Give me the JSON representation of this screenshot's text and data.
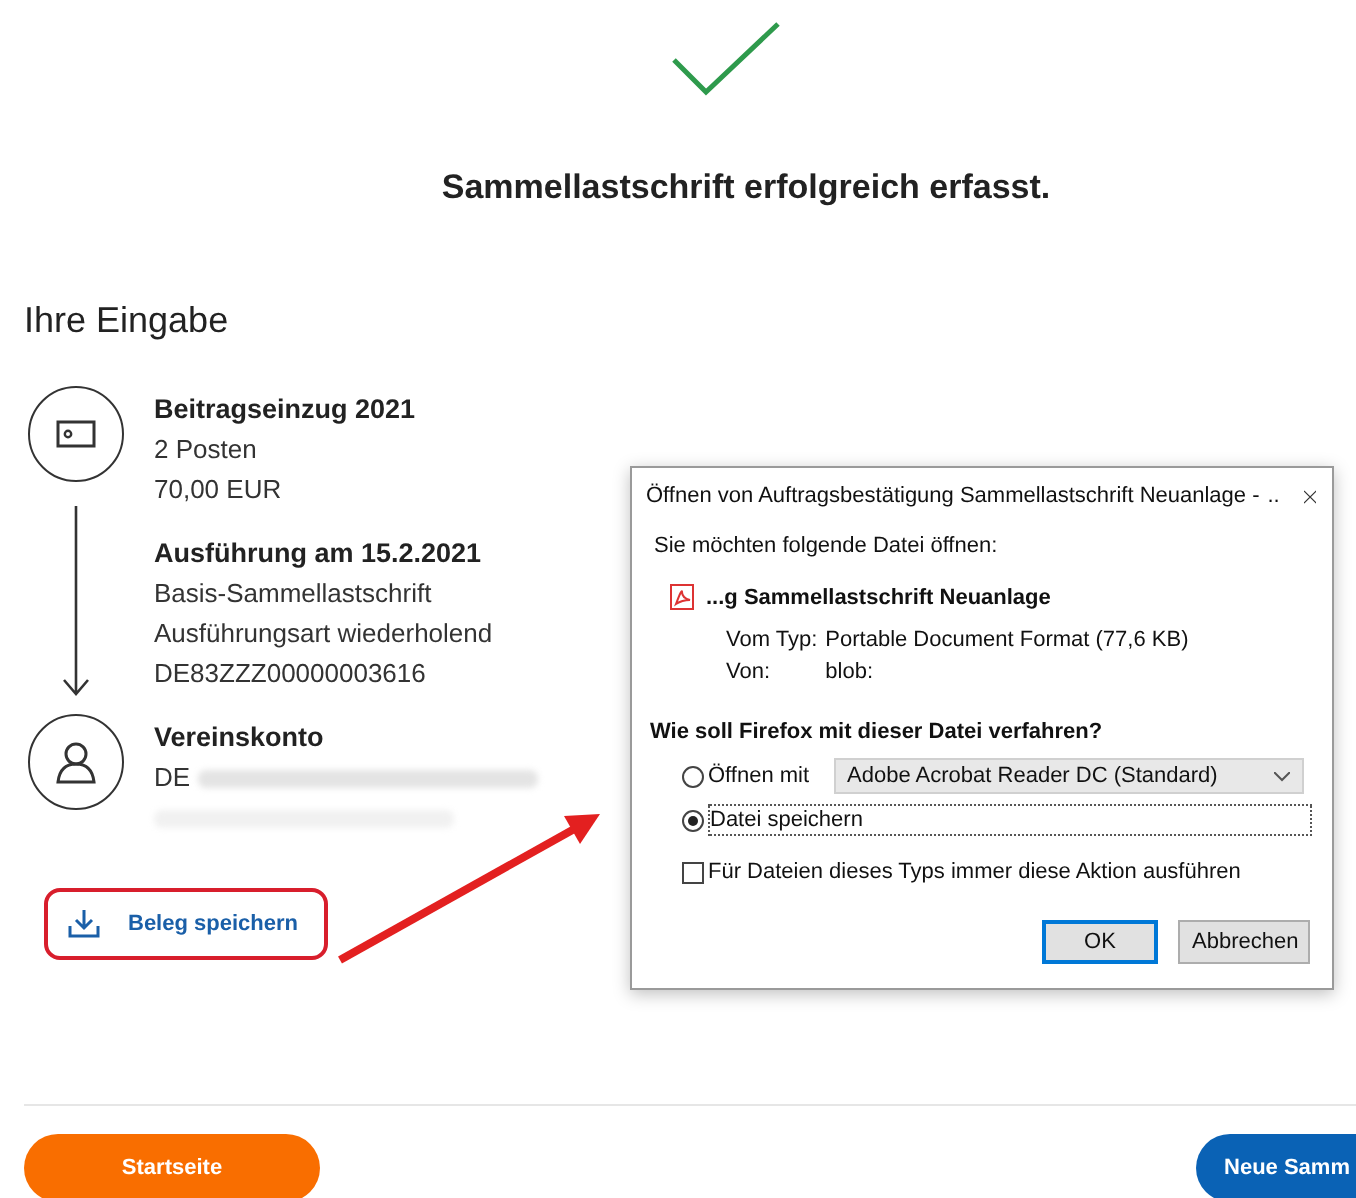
{
  "success": {
    "title": "Sammellastschrift erfolgreich erfasst."
  },
  "section_title": "Ihre Eingabe",
  "timeline": [
    {
      "kind": "card",
      "title": "Beitragseinzug 2021",
      "lines": [
        "2 Posten",
        "70,00 EUR"
      ],
      "redacted": false
    },
    {
      "kind": "arrow",
      "title": "Ausführung am 15.2.2021",
      "lines": [
        "Basis-Sammellastschrift",
        "Ausführungsart wiederholend",
        "DE83ZZZ00000003616"
      ],
      "redacted": false
    },
    {
      "kind": "person",
      "title": "Vereinskonto",
      "lines": [
        "DE"
      ],
      "redacted": true
    }
  ],
  "save_receipt": {
    "label": "Beleg speichern",
    "highlighted": true
  },
  "buttons": [
    {
      "label": "Startseite",
      "kind": "primary"
    },
    {
      "label": "Neue Samm",
      "kind": "secondary"
    }
  ],
  "dialog": {
    "title": "Öffnen von Auftragsbestätigung Sammellastschrift Neuanlage -",
    "title_tail": "..",
    "prompt": "Sie möchten folgende Datei öffnen:",
    "file_name": "...g Sammellastschrift Neuanlage",
    "details": [
      {
        "label": "Vom Typ:",
        "value": "Portable Document Format (77,6 KB)"
      },
      {
        "label": "Von:",
        "value": "blob:"
      }
    ],
    "question": "Wie soll Firefox mit dieser Datei verfahren?",
    "options": [
      {
        "label": "Öffnen mit",
        "selected": false,
        "app": "Adobe Acrobat Reader DC (Standard)"
      },
      {
        "label": "Datei speichern",
        "selected": true
      }
    ],
    "always": {
      "label": "Für Dateien dieses Typs immer diese Aktion ausführen",
      "checked": false
    },
    "buttons": [
      {
        "label": "OK",
        "default": true
      },
      {
        "label": "Abbrechen",
        "default": false
      }
    ]
  }
}
